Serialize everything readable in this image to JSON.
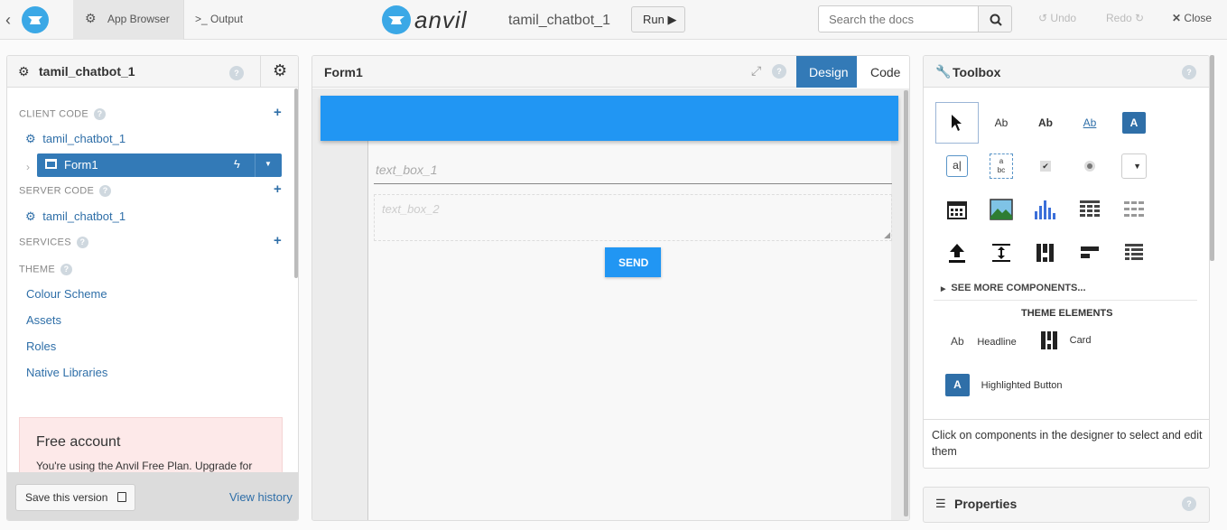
{
  "topbar": {
    "app_browser": "App Browser",
    "output": ">_ Output",
    "logo": "anvil",
    "app_name": "tamil_chatbot_1",
    "run": "Run ▶",
    "search_placeholder": "Search the docs",
    "undo": "Undo",
    "redo": "Redo",
    "close": "Close"
  },
  "sidebar": {
    "title": "tamil_chatbot_1",
    "client_code": "CLIENT CODE",
    "client_module": "tamil_chatbot_1",
    "form": "Form1",
    "server_code": "SERVER CODE",
    "server_module": "tamil_chatbot_1",
    "services": "SERVICES",
    "theme": "THEME",
    "theme_items": [
      "Colour Scheme",
      "Assets",
      "Roles",
      "Native Libraries"
    ],
    "free_title": "Free account",
    "free_text": "You're using the Anvil Free Plan. Upgrade for",
    "save_version": "Save this version",
    "view_history": "View history"
  },
  "editor": {
    "form_title": "Form1",
    "tab_design": "Design",
    "tab_code": "Code",
    "text_box_1": "text_box_1",
    "text_box_2": "text_box_2",
    "send": "SEND"
  },
  "toolbox": {
    "title": "Toolbox",
    "see_more": "SEE MORE COMPONENTS...",
    "theme_elements": "THEME ELEMENTS",
    "headline": "Headline",
    "card": "Card",
    "highlighted_button": "Highlighted Button",
    "hint": "Click on components in the designer to select and edit them",
    "properties": "Properties"
  },
  "colors": {
    "accent": "#2f6fa8",
    "primary_blue": "#2196f3",
    "selected_form": "#337ab7"
  }
}
